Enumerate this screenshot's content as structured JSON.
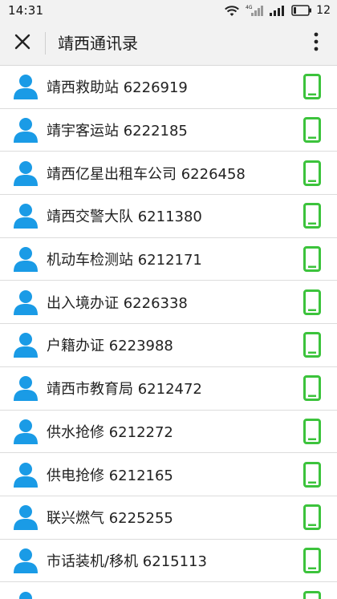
{
  "status_bar": {
    "time": "14:31",
    "network": "4G",
    "battery": "12"
  },
  "header": {
    "title": "靖西通讯录"
  },
  "icons": {
    "close": "close-icon",
    "more": "more-vertical-icon",
    "avatar": "person-icon",
    "phone": "phone-icon"
  },
  "colors": {
    "avatar": "#1a9be6",
    "phone": "#3cc33c"
  },
  "contacts": [
    {
      "label": "靖西救助站 6226919"
    },
    {
      "label": "靖宇客运站 6222185"
    },
    {
      "label": "靖西亿星出租车公司 6226458"
    },
    {
      "label": "靖西交警大队 6211380"
    },
    {
      "label": "机动车检测站 6212171"
    },
    {
      "label": "出入境办证 6226338"
    },
    {
      "label": "户籍办证 6223988"
    },
    {
      "label": "靖西市教育局 6212472"
    },
    {
      "label": "供水抢修 6212272"
    },
    {
      "label": "供电抢修 6212165"
    },
    {
      "label": "联兴燃气 6225255"
    },
    {
      "label": "市话装机/移机 6215113"
    },
    {
      "label": ""
    }
  ]
}
